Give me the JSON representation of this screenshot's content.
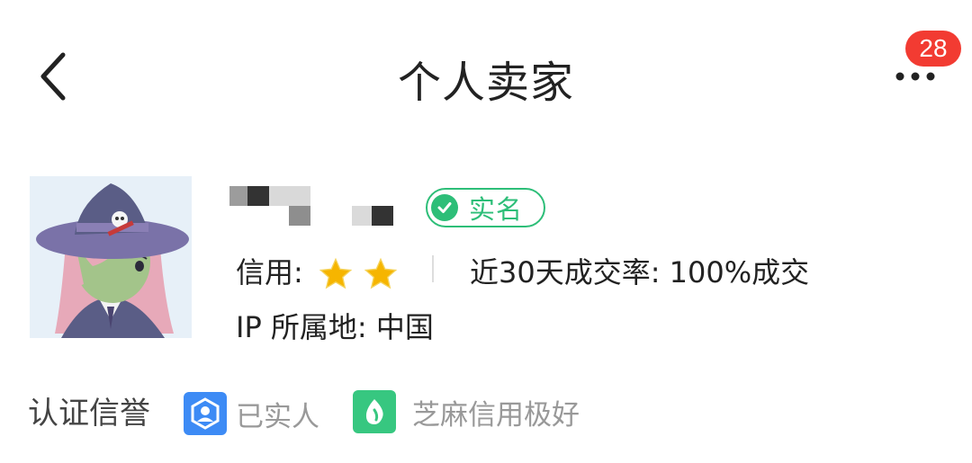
{
  "header": {
    "title": "个人卖家",
    "notification_count": "28"
  },
  "seller": {
    "verified_label": "实名",
    "credit_label": "信用:",
    "credit_stars": 2,
    "deal_rate": "近30天成交率: 100%成交",
    "ip_location": "IP 所属地: 中国"
  },
  "certification": {
    "title": "认证信誉",
    "items": [
      {
        "label": "已实人",
        "icon": "person-verify-icon",
        "color": "#3d8bf5"
      },
      {
        "label": "芝麻信用极好",
        "icon": "sesame-credit-icon",
        "color": "#37c780"
      }
    ]
  },
  "colors": {
    "accent_green": "#2dbe78",
    "badge_red": "#f23b32",
    "star_gold": "#f6b500"
  }
}
